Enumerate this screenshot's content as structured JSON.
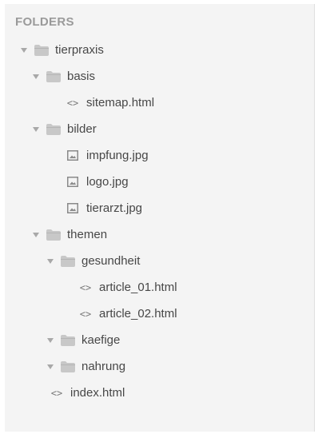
{
  "sidebar": {
    "header": "FOLDERS",
    "items": [
      {
        "label": "tierpraxis",
        "type": "folder",
        "depth": 0
      },
      {
        "label": "basis",
        "type": "folder",
        "depth": 1
      },
      {
        "label": "sitemap.html",
        "type": "code",
        "depth": 2
      },
      {
        "label": "bilder",
        "type": "folder",
        "depth": 1
      },
      {
        "label": "impfung.jpg",
        "type": "image",
        "depth": 2
      },
      {
        "label": "logo.jpg",
        "type": "image",
        "depth": 2
      },
      {
        "label": "tierarzt.jpg",
        "type": "image",
        "depth": 2
      },
      {
        "label": "themen",
        "type": "folder",
        "depth": 1
      },
      {
        "label": "gesundheit",
        "type": "folder",
        "depth": 2
      },
      {
        "label": "article_01.html",
        "type": "code",
        "depth": 3
      },
      {
        "label": "article_02.html",
        "type": "code",
        "depth": 3
      },
      {
        "label": "kaefige",
        "type": "folder",
        "depth": 2
      },
      {
        "label": "nahrung",
        "type": "folder",
        "depth": 2
      },
      {
        "label": "index.html",
        "type": "code",
        "depth": 1
      }
    ],
    "code_glyph": "<>",
    "colors": {
      "panel_bg": "#f4f4f4",
      "header": "#9a9a9a",
      "folder": "#c8c8c8",
      "text": "#474747"
    }
  }
}
